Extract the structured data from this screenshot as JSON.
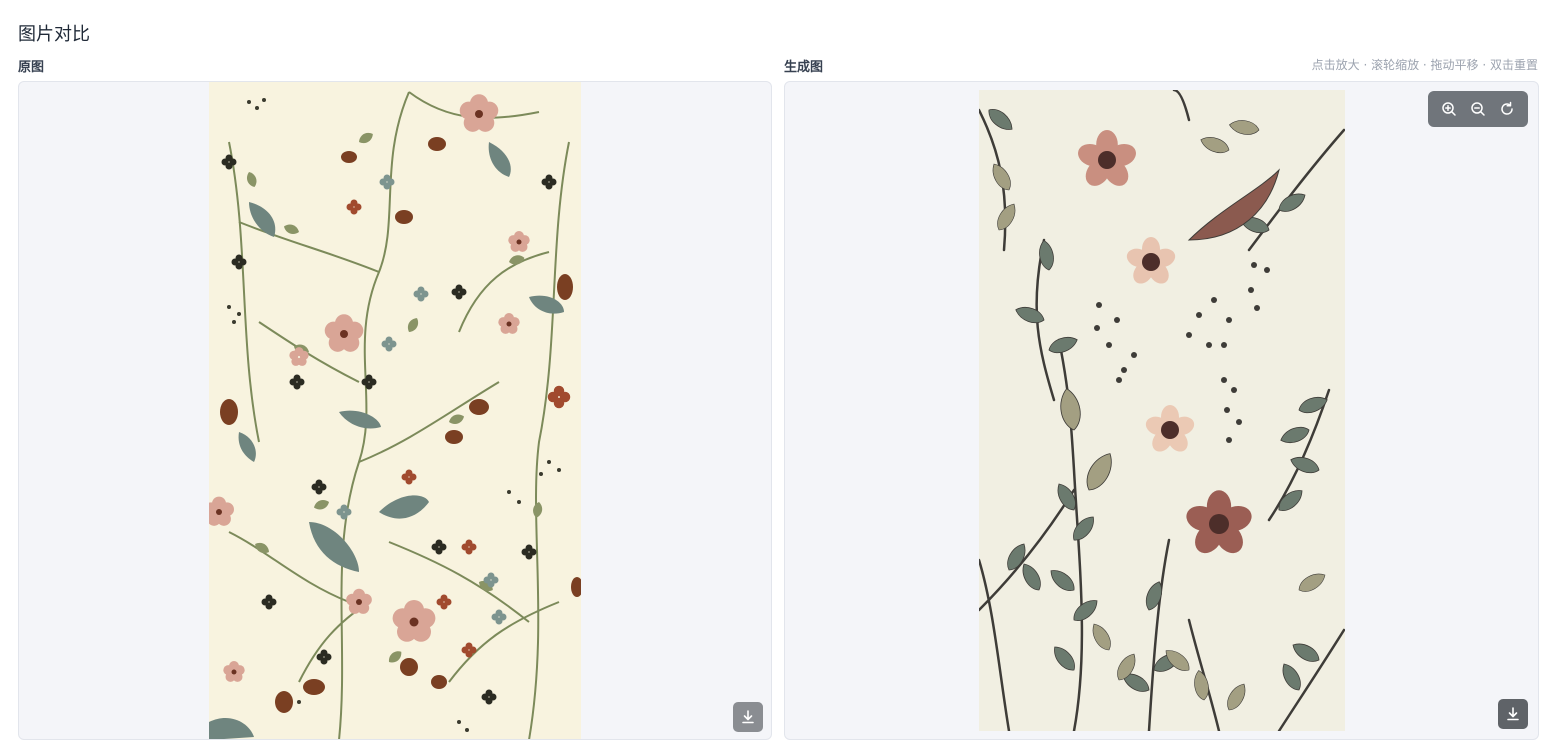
{
  "page": {
    "title": "图片对比"
  },
  "left_panel": {
    "label": "原图"
  },
  "right_panel": {
    "label": "生成图",
    "hint": "点击放大 · 滚轮缩放 · 拖动平移 · 双击重置"
  },
  "icons": {
    "zoom_in": "zoom-in-icon",
    "zoom_out": "zoom-out-icon",
    "reset": "rotate-reset-icon",
    "download": "download-icon"
  },
  "colors": {
    "panel_bg": "#f4f5f9",
    "original_bg": "#f8f3df",
    "generated_bg": "#f1efe2",
    "toolbar_bg": "#64696f"
  }
}
